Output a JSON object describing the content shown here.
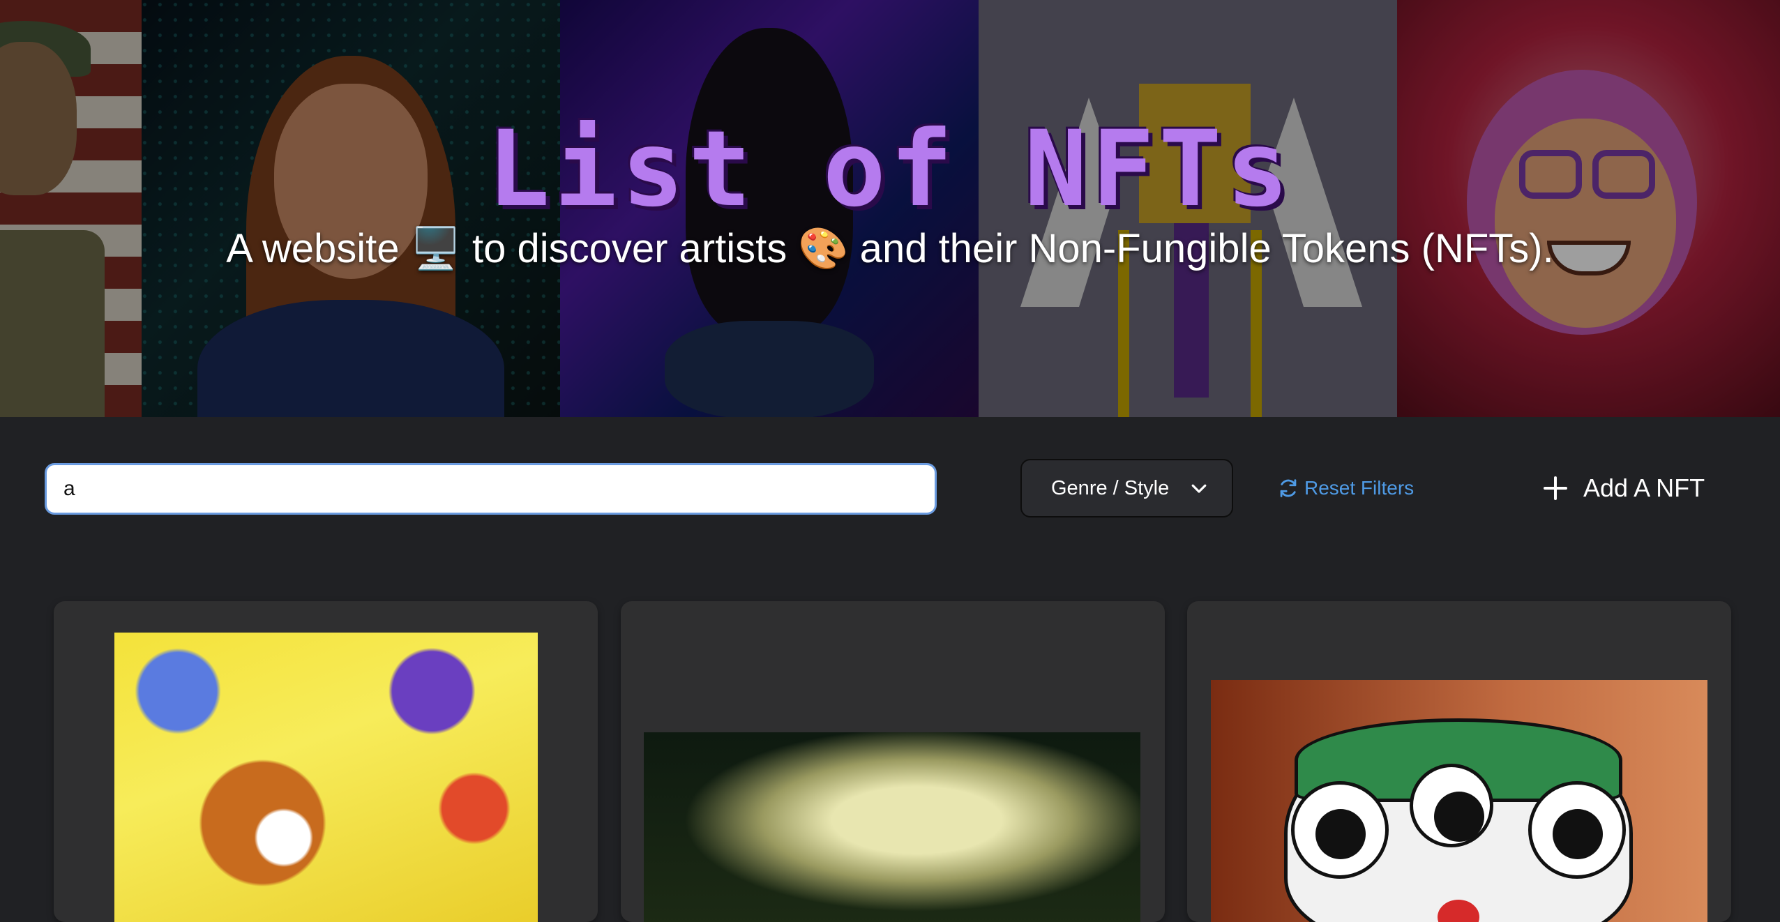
{
  "hero": {
    "title": "List of NFTs",
    "subtitle": "A website 🖥️ to discover artists 🎨 and their Non-Fungible Tokens (NFTs)."
  },
  "filters": {
    "search_value": "a",
    "genre_label": "Genre / Style",
    "reset_label": "Reset Filters",
    "add_label": "Add A NFT"
  },
  "icons": {
    "genre": "chevron-down-icon",
    "reset": "refresh-icon",
    "add": "plus-icon"
  },
  "colors": {
    "title": "#b57bee",
    "link": "#4f9be6",
    "background": "#202124",
    "card": "#2f2f30"
  }
}
